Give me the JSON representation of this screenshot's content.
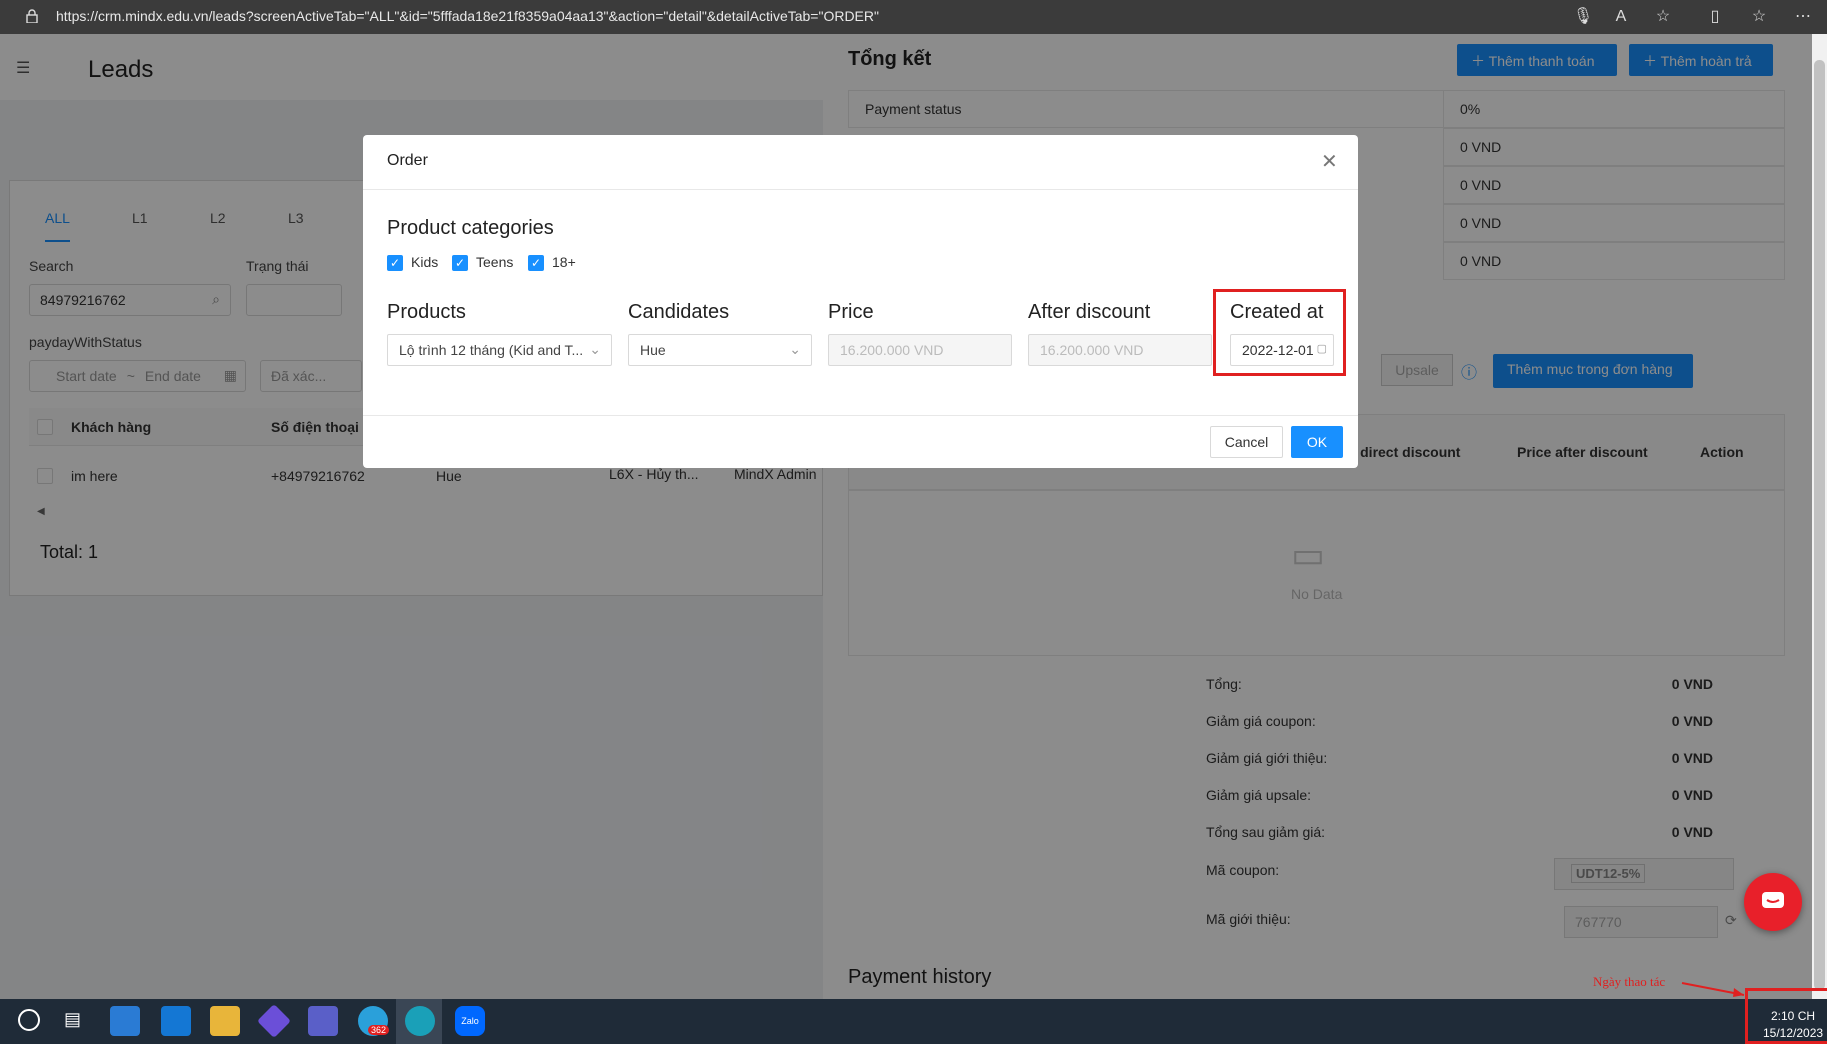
{
  "browser": {
    "url": "https://crm.mindx.edu.vn/leads?screenActiveTab=\"ALL\"&id=\"5fffada18e21f8359a04aa13\"&action=\"detail\"&detailActiveTab=\"ORDER\""
  },
  "leads_page": {
    "title": "Leads",
    "tabs": [
      "ALL",
      "L1",
      "L2",
      "L3"
    ],
    "search_label": "Search",
    "search_value": "84979216762",
    "status_label": "Trạng thái",
    "payday_label": "paydayWithStatus",
    "start_date_placeholder": "Start date",
    "end_date_placeholder": "End date",
    "confirmed_placeholder": "Đã xác...",
    "columns": [
      "Khách hàng",
      "Số điện thoại"
    ],
    "row": {
      "customer": "im here",
      "phone": "+84979216762",
      "city": "Hue",
      "product": "L6X - Hủy th...",
      "owner": "MindX Admin"
    },
    "total": "Total: 1"
  },
  "order_panel": {
    "summary_title": "Tổng kết",
    "add_payment": "Thêm thanh toán",
    "add_refund": "Thêm hoàn trả",
    "payment_rows": [
      {
        "label": "Payment status",
        "value": "0%"
      },
      {
        "label": "",
        "value": "0 VND"
      },
      {
        "label": "",
        "value": "0 VND"
      },
      {
        "label": "",
        "value": "0 VND"
      },
      {
        "label": "",
        "value": "0 VND"
      }
    ],
    "upsale_label": "Upsale",
    "add_item": "Thêm mục trong đơn hàng",
    "table_columns": [
      "er direct discount",
      "Price after discount",
      "Action"
    ],
    "no_data": "No Data",
    "totals": [
      {
        "label": "Tổng:",
        "value": "0 VND"
      },
      {
        "label": "Giảm giá coupon:",
        "value": "0 VND"
      },
      {
        "label": "Giảm giá giới thiệu:",
        "value": "0 VND"
      },
      {
        "label": "Giảm giá upsale:",
        "value": "0 VND"
      },
      {
        "label": "Tổng sau giảm giá:",
        "value": "0 VND"
      }
    ],
    "coupon_label": "Mã coupon:",
    "coupon_value": "UDT12-5%",
    "referral_label": "Mã giới thiệu:",
    "referral_value": "767770",
    "payment_history": "Payment history"
  },
  "modal": {
    "title": "Order",
    "categories_heading": "Product categories",
    "categories": [
      "Kids",
      "Teens",
      "18+"
    ],
    "products_label": "Products",
    "products_value": "Lộ trình 12 tháng (Kid and T...",
    "candidates_label": "Candidates",
    "candidates_value": "Hue",
    "price_label": "Price",
    "price_value": "16.200.000 VND",
    "after_discount_label": "After discount",
    "after_discount_value": "16.200.000 VND",
    "created_at_label": "Created at",
    "created_at_value": "2022-12-01",
    "cancel": "Cancel",
    "ok": "OK"
  },
  "annotation": {
    "note": "Ngày thao tác",
    "color": "#e02020"
  },
  "taskbar": {
    "time": "2:10 CH",
    "date": "15/12/2023",
    "telegram_badge": "362",
    "zalo_label": "Zalo"
  },
  "colors": {
    "primary": "#1890ff",
    "highlight": "#e02020",
    "chat_button": "#e8202a"
  }
}
